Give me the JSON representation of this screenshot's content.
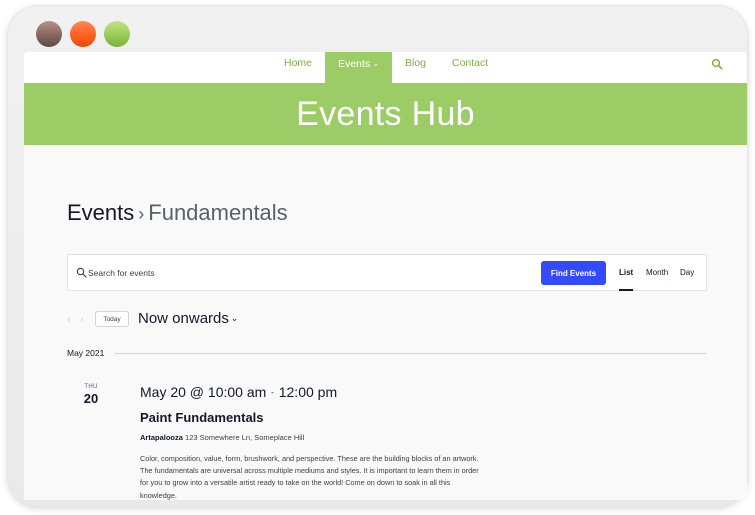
{
  "nav": {
    "items": [
      {
        "label": "Home"
      },
      {
        "label": "Events",
        "active": true
      },
      {
        "label": "Blog"
      },
      {
        "label": "Contact"
      }
    ]
  },
  "hero": {
    "title": "Events Hub"
  },
  "breadcrumb": {
    "parent": "Events",
    "separator": "›",
    "current": "Fundamentals"
  },
  "search": {
    "placeholder": "Search for events",
    "value": "",
    "button_label": "Find Events"
  },
  "views": [
    {
      "label": "List",
      "active": true
    },
    {
      "label": "Month"
    },
    {
      "label": "Day"
    }
  ],
  "date_nav": {
    "today_label": "Today",
    "range_label": "Now onwards"
  },
  "month_separator": "May 2021",
  "event": {
    "weekday": "THU",
    "day": "20",
    "start": "May 20 @ 10:00 am",
    "separator": "-",
    "end": "12:00 pm",
    "title": "Paint Fundamentals",
    "venue_name": "Artapalooza",
    "venue_address": "123 Somewhere Ln, Someplace Hill",
    "description": "Color, composition, value, form, brushwork, and perspective. These are the building blocks of an artwork. The fundamentals are universal across multiple mediums and styles. It is important to learn them in order for you to grow into a versatile artist ready to take on the world! Come on down to soak in all this knowledge."
  },
  "colors": {
    "accent_green": "#9ccc65",
    "nav_text_green": "#7cb342",
    "button_blue": "#334aff",
    "text_dark": "#141827",
    "window_dot_1": "#8a6a62",
    "window_dot_2": "#ff5f1f",
    "window_dot_3": "#98cc52"
  },
  "icons": {
    "nav_search": "search-icon",
    "search_field": "search-icon",
    "prev": "chevron-left-icon",
    "next": "chevron-right-icon",
    "caret": "chevron-down-icon"
  }
}
